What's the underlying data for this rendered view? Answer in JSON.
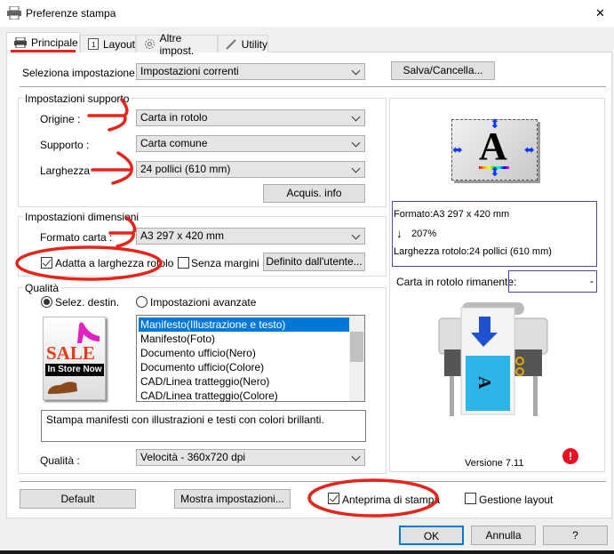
{
  "window": {
    "title": "Preferenze stampa",
    "close": "✕"
  },
  "tabs": [
    {
      "label": "Principale",
      "icon": "printer-icon"
    },
    {
      "label": "Layout",
      "icon": "page-icon"
    },
    {
      "label": "Altre impost.",
      "icon": "gear-icon"
    },
    {
      "label": "Utility",
      "icon": "wrench-icon"
    }
  ],
  "preset": {
    "label": "Seleziona impostazione :",
    "value": "Impostazioni correnti",
    "save_button": "Salva/Cancella..."
  },
  "media": {
    "title": "Impostazioni supporto",
    "source_label": "Origine :",
    "source": "Carta in rotolo",
    "type_label": "Supporto :",
    "type": "Carta comune",
    "width_label": "Larghezza",
    "width": "24 pollici (610 mm)",
    "acquire_button": "Acquis. info"
  },
  "size": {
    "title": "Impostazioni dimensioni",
    "paper_label": "Formato carta :",
    "paper": "A3 297 x 420 mm",
    "fit_roll": {
      "label": "Adatta a larghezza rotolo",
      "checked": true
    },
    "borderless": {
      "label": "Senza margini",
      "checked": false
    },
    "custom_button": "Definito dall'utente..."
  },
  "quality": {
    "title": "Qualità",
    "radio_target": {
      "label": "Selez. destin.",
      "selected": true
    },
    "radio_advanced": {
      "label": "Impostazioni avanzate",
      "selected": false
    },
    "image_text": "SALE",
    "image_subtext": "In Store Now",
    "targets": [
      "Manifesto(Illustrazione e testo)",
      "Manifesto(Foto)",
      "Documento ufficio(Nero)",
      "Documento ufficio(Colore)",
      "CAD/Linea tratteggio(Nero)",
      "CAD/Linea tratteggio(Colore)"
    ],
    "selected_target": 0,
    "description": "Stampa manifesti con illustrazioni e testi con colori brillanti.",
    "quality_label": "Qualità :",
    "quality_value": "Velocità - 360x720 dpi"
  },
  "preview": {
    "letter": "A",
    "info_format": "Formato:A3 297 x 420 mm",
    "info_scale": "207%",
    "info_roll": "Larghezza rotolo:24 pollici (610 mm)",
    "remaining_label": "Carta in rotolo rimanente:",
    "remaining_value": "-",
    "version": "Versione 7.11"
  },
  "bottom": {
    "default_button": "Default",
    "show_button": "Mostra impostazioni...",
    "print_preview": {
      "label": "Anteprima di stampa",
      "checked": true
    },
    "layout_manager": {
      "label": "Gestione layout",
      "checked": false
    }
  },
  "dialog": {
    "ok": "OK",
    "cancel": "Annulla",
    "help": "?"
  },
  "colors": {
    "selection": "#0078d7",
    "annotation": "#e8231a",
    "error": "#e81123"
  }
}
